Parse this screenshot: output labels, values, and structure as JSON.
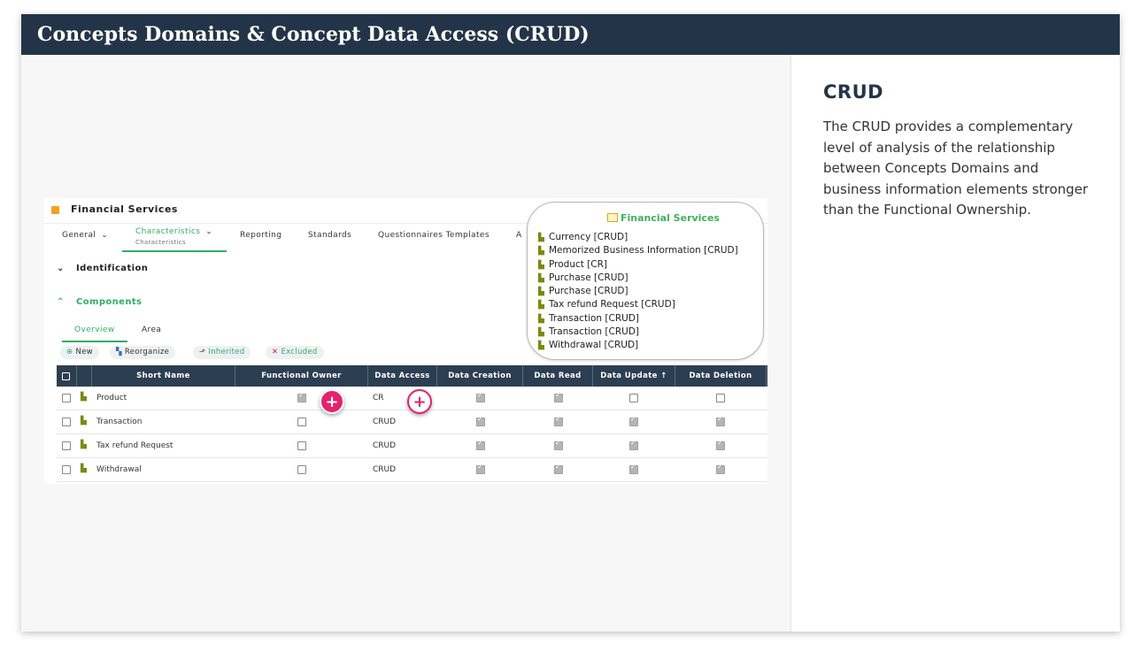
{
  "page": {
    "title": "Concepts Domains & Concept Data Access (CRUD)"
  },
  "right_panel": {
    "heading": "CRUD",
    "description": "The CRUD provides a complementary level of analysis of the relationship between Concepts Domains and business information elements stronger than the Functional Ownership."
  },
  "app": {
    "object_title": "Financial Services",
    "nav_tabs": [
      {
        "label": "General"
      },
      {
        "label": "Characteristics",
        "sublabel": "Characteristics"
      },
      {
        "label": "Reporting"
      },
      {
        "label": "Standards"
      },
      {
        "label": "Questionnaires Templates"
      },
      {
        "label": "A"
      }
    ],
    "sections": {
      "identification": "Identification",
      "components": "Components"
    },
    "sub_tabs": [
      "Overview",
      "Area"
    ],
    "toolbar": {
      "new": "New",
      "reorganize": "Reorganize",
      "inherited": "Inherited",
      "excluded": "Excluded"
    },
    "grid": {
      "columns": [
        "Short Name",
        "Functional Owner",
        "Data Access",
        "Data Creation",
        "Data Read",
        "Data Update",
        "Data Deletion"
      ],
      "rows": [
        {
          "name": "Product",
          "functional_owner": true,
          "data_access": "CR",
          "creation": true,
          "read": true,
          "update": false,
          "deletion": false
        },
        {
          "name": "Transaction",
          "functional_owner": false,
          "data_access": "CRUD",
          "creation": true,
          "read": true,
          "update": true,
          "deletion": true
        },
        {
          "name": "Tax refund Request",
          "functional_owner": false,
          "data_access": "CRUD",
          "creation": true,
          "read": true,
          "update": true,
          "deletion": true
        },
        {
          "name": "Withdrawal",
          "functional_owner": false,
          "data_access": "CRUD",
          "creation": true,
          "read": true,
          "update": true,
          "deletion": true
        }
      ]
    },
    "callout": {
      "title": "Financial Services",
      "items": [
        "Currency [CRUD]",
        "Memorized Business Information [CRUD]",
        "Product [CR]",
        "Purchase [CRUD]",
        "Purchase [CRUD]",
        "Tax refund Request [CRUD]",
        "Transaction [CRUD]",
        "Transaction [CRUD]",
        "Withdrawal [CRUD]"
      ]
    }
  },
  "colors": {
    "title_bar": "#243448",
    "accent_green": "#2fae63",
    "grid_header": "#2c3e52",
    "highlight_pink": "#e5226b"
  }
}
